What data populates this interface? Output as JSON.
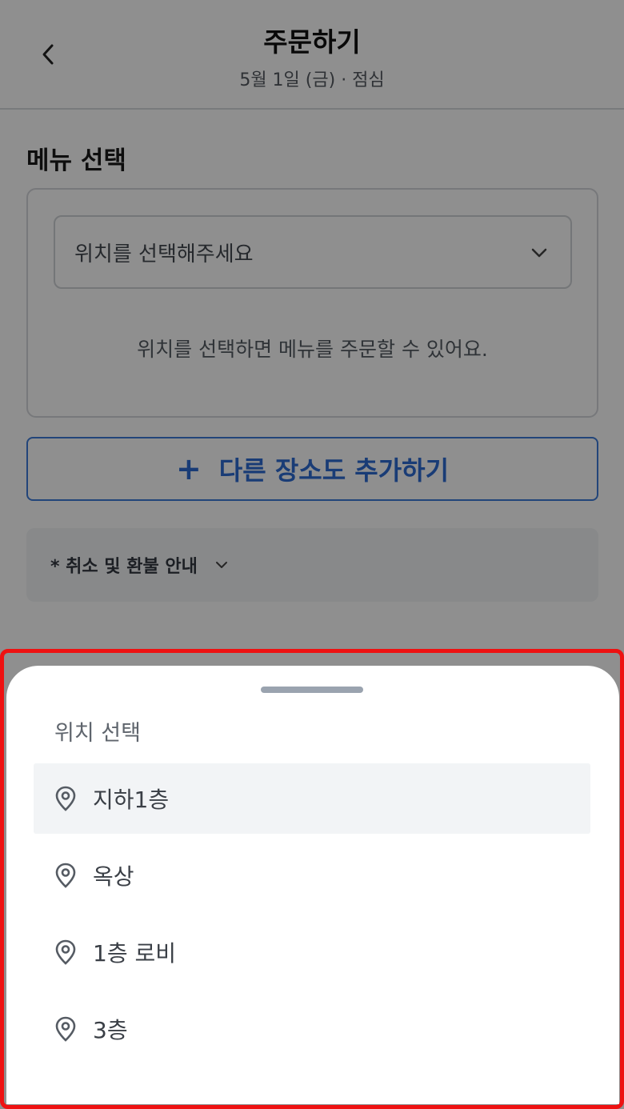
{
  "header": {
    "title": "주문하기",
    "subtitle": "5월 1일 (금) · 점심",
    "back_icon": "chevron-left-icon"
  },
  "menu_section": {
    "title": "메뉴 선택",
    "location_placeholder": "위치를 선택해주세요",
    "hint": "위치를 선택하면 메뉴를 주문할 수 있어요."
  },
  "add_place": {
    "icon": "plus-icon",
    "plus_glyph": "+",
    "label": "다른 장소도 추가하기"
  },
  "refund": {
    "label": "* 취소 및 환불 안내"
  },
  "sheet": {
    "title": "위치 선택",
    "options": [
      {
        "label": "지하1층",
        "selected": true
      },
      {
        "label": "옥상",
        "selected": false
      },
      {
        "label": "1층 로비",
        "selected": false
      },
      {
        "label": "3층",
        "selected": false
      }
    ]
  },
  "colors": {
    "accent": "#2e6bd3",
    "highlight_frame": "#ee1111",
    "overlay": "rgba(0,0,0,0.44)"
  }
}
